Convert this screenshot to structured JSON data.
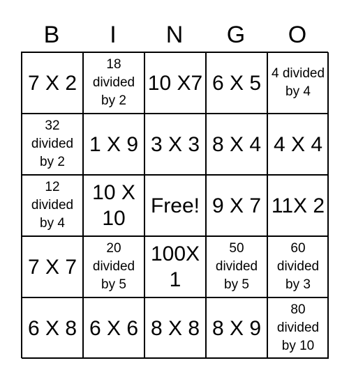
{
  "header": [
    "B",
    "I",
    "N",
    "G",
    "O"
  ],
  "cells": [
    [
      "7 X 2",
      "18 divided by 2",
      "10 X7",
      "6 X 5",
      "4 divided by 4"
    ],
    [
      "32 divided by 2",
      "1 X 9",
      "3 X 3",
      "8 X 4",
      "4 X 4"
    ],
    [
      "12 divided by 4",
      "10 X 10",
      "Free!",
      "9 X 7",
      "11X 2"
    ],
    [
      "7 X 7",
      "20 divided by 5",
      "100X 1",
      "50 divided by 5",
      "60 divided by 3"
    ],
    [
      "6 X 8",
      "6 X 6",
      "8 X 8",
      "8 X 9",
      "80 divided by 10"
    ]
  ]
}
